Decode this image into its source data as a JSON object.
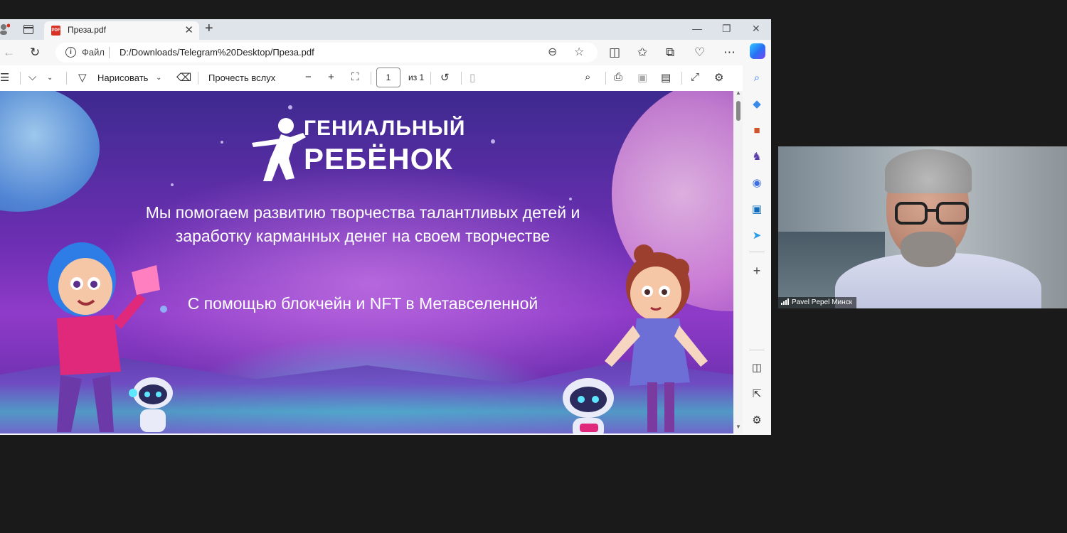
{
  "browser": {
    "tab": {
      "title": "Преза.pdf",
      "icon": "pdf-file-icon",
      "icon_text": "PDF"
    },
    "newtab_label": "+",
    "address": {
      "site_label": "Файл",
      "url": "D:/Downloads/Telegram%20Desktop/Преза.pdf"
    }
  },
  "pdf_toolbar": {
    "draw_label": "Нарисовать",
    "read_aloud_label": "Прочесть вслух",
    "page_current": "1",
    "page_total": "из 1"
  },
  "slide": {
    "brand_line1": "ГЕНИАЛЬНЫЙ",
    "brand_line2": "РЕБЁНОК",
    "tagline": "Мы помогаем развитию творчества талантливых детей и заработку карманных денег на своем творчестве",
    "subtag": "С помощью блокчейн и NFT в Метавселенной"
  },
  "video": {
    "participant_name": "Pavel Pepel Минск"
  },
  "colors": {
    "accent": "#2a6df4",
    "slide_purple": "#6d2fb3",
    "slide_cyan": "#5ad2e6"
  }
}
